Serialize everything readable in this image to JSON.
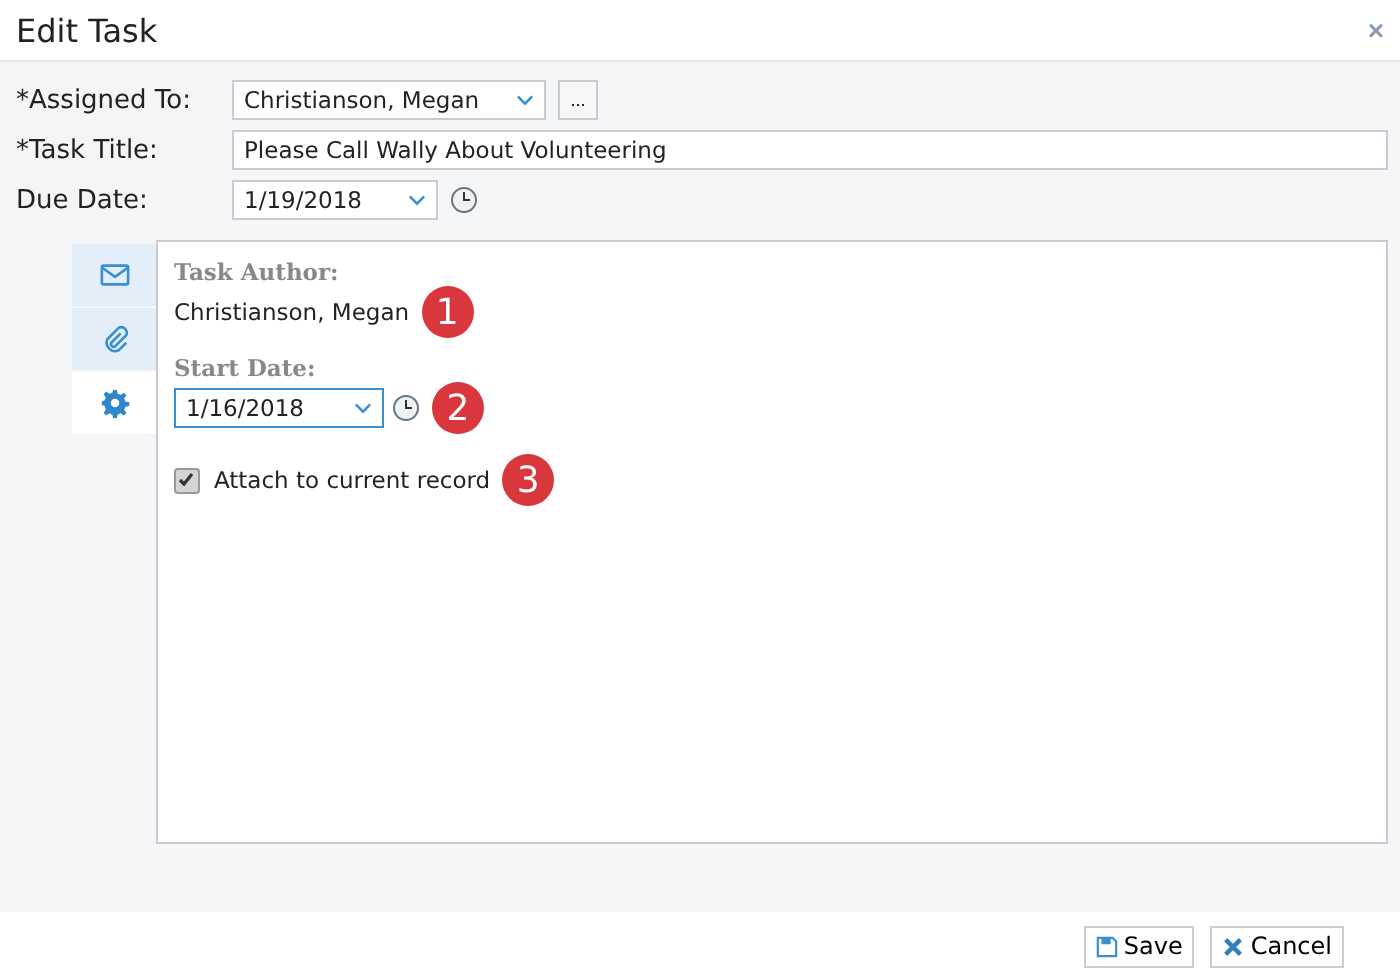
{
  "window": {
    "title": "Edit Task",
    "close": "×"
  },
  "fields": [
    {
      "label": "*Assigned To:",
      "kind": "dropdown",
      "value": "Christianson, Megan",
      "extra": "..."
    },
    {
      "label": "*Task Title:",
      "kind": "text",
      "value": "Please Call Wally About Volunteering"
    },
    {
      "label": "Due Date:",
      "kind": "date",
      "value": "1/19/2018"
    }
  ],
  "side_tabs": [
    {
      "kind": "mail",
      "selected": false
    },
    {
      "kind": "clip",
      "selected": false
    },
    {
      "kind": "gear",
      "selected": true
    }
  ],
  "panel": {
    "author_label": "Task Author:",
    "author": "Christianson, Megan",
    "start_label": "Start Date:",
    "start_date": "1/16/2018",
    "attach": {
      "label": "Attach to current record",
      "checked": true
    }
  },
  "callouts": [
    "1",
    "2",
    "3"
  ],
  "buttons": [
    {
      "label": "Save",
      "kind": "save"
    },
    {
      "label": "Cancel",
      "kind": "cancel"
    }
  ]
}
